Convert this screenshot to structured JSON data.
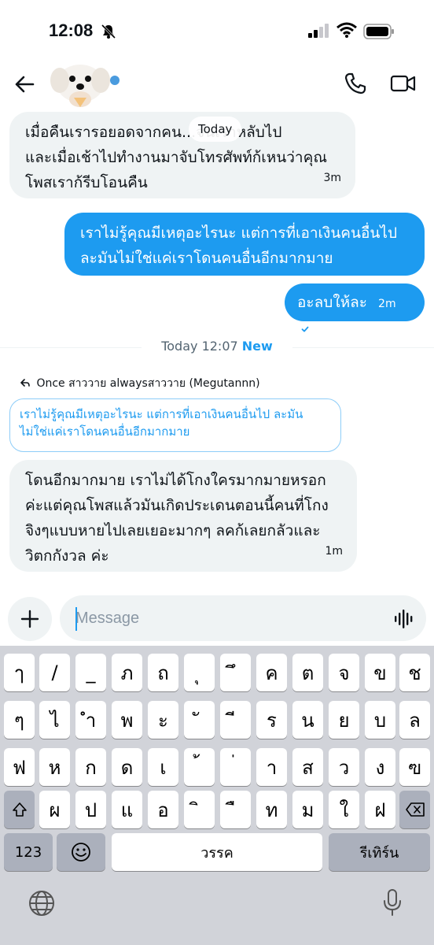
{
  "status": {
    "time": "12:08"
  },
  "header": {
    "back_icon": "arrow-left-icon",
    "avatar": "dog-avatar-with-emoji",
    "call_icon": "phone-icon",
    "video_icon": "video-camera-icon"
  },
  "date_pill": "Today",
  "messages": [
    {
      "direction": "in",
      "lines": [
        "เมื่อคืนเรารอยอดจากคน...จนเราหลับไป",
        "และเมื่อเช้าไปทำงานมาจับโทรศัพท์ก้เหนว่าคุณ",
        "โพสเราก้รีบโอนคืน"
      ],
      "time": "3m"
    },
    {
      "direction": "out",
      "lines": [
        "เราไม่รู้คุณมีเหตุอะไรนะ แต่การที่เอาเงินคนอื่นไป",
        "ละมันไม่ใช่แค่เราโดนคนอื่นอีกมากมาย"
      ]
    },
    {
      "direction": "out",
      "text": "อะลบให้ละ",
      "time": "2m",
      "status_icon": "check-circle-icon"
    }
  ],
  "separator": {
    "text": "Today 12:07",
    "new_label": "New"
  },
  "reply": {
    "meta": "Once สาววาย alwaysสาววาย (Megutannn)",
    "quote_lines": [
      "เราไม่รู้คุณมีเหตุอะไรนะ แต่การที่เอาเงินคนอื่นไป ละมัน",
      "ไม่ใช่แค่เราโดนคนอื่นอีกมากมาย"
    ]
  },
  "last_message": {
    "lines": [
      "โดนอีกมากมาย เราไม่ได้โกงใครมากมายหรอก",
      "ค่ะแต่คุณโพสแล้วมันเกิดประเดนตอนนี้คนที่โกง",
      "จิงๆแบบหายไปเลยเยอะมากๆ ลคก้เลยกลัวและ",
      "วิตกกังวล ค่ะ"
    ],
    "time": "1m"
  },
  "composer": {
    "placeholder": "Message"
  },
  "keyboard": {
    "row1": [
      "ๅ",
      "/",
      "_",
      "ภ",
      "ถ",
      "ุ",
      "ึ",
      "ค",
      "ต",
      "จ",
      "ข",
      "ช"
    ],
    "row2": [
      "ๆ",
      "ไ",
      "ำ",
      "พ",
      "ะ",
      "ั",
      "ี",
      "ร",
      "น",
      "ย",
      "บ",
      "ล"
    ],
    "row3": [
      "ฟ",
      "ห",
      "ก",
      "ด",
      "เ",
      "้",
      "่",
      "า",
      "ส",
      "ว",
      "ง",
      "ฃ"
    ],
    "row4": [
      "ผ",
      "ป",
      "แ",
      "อ",
      "ิ",
      "ื",
      "ท",
      "ม",
      "ใ",
      "ฝ"
    ],
    "numbers_label": "123",
    "space_label": "วรรค",
    "return_label": "รีเทิร์น"
  }
}
